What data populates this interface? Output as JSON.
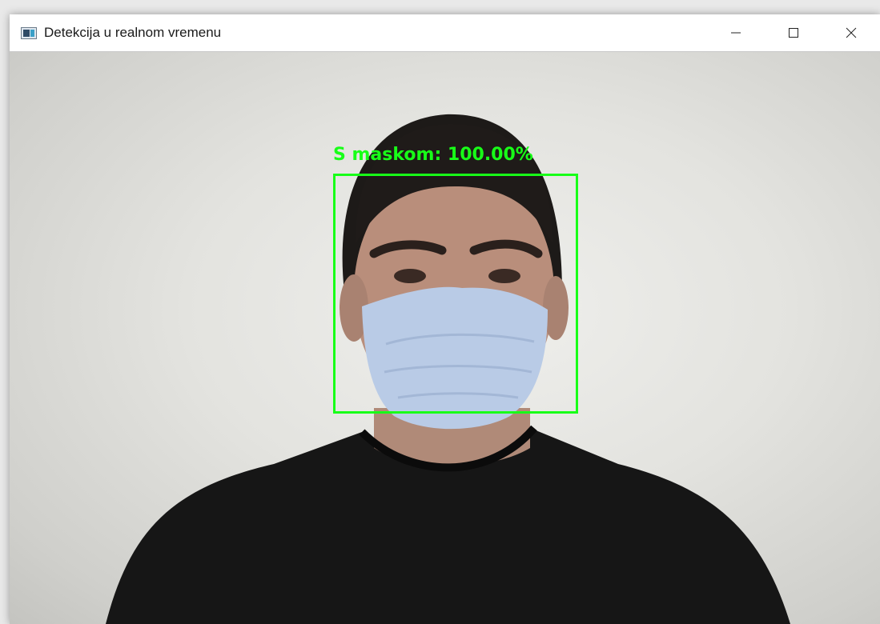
{
  "window": {
    "title": "Detekcija u realnom vremenu",
    "app_icon": "opencv-window-icon",
    "controls": {
      "minimize_icon": "minimize-icon",
      "maximize_icon": "maximize-icon",
      "close_icon": "close-icon"
    }
  },
  "detection": {
    "label": "S maskom: 100.00%",
    "box_color": "#18ff18"
  },
  "colors": {
    "titlebar_bg": "#ffffff",
    "wall": "#e3e3df",
    "mask": "#b9cbe6",
    "shirt": "#161616"
  }
}
